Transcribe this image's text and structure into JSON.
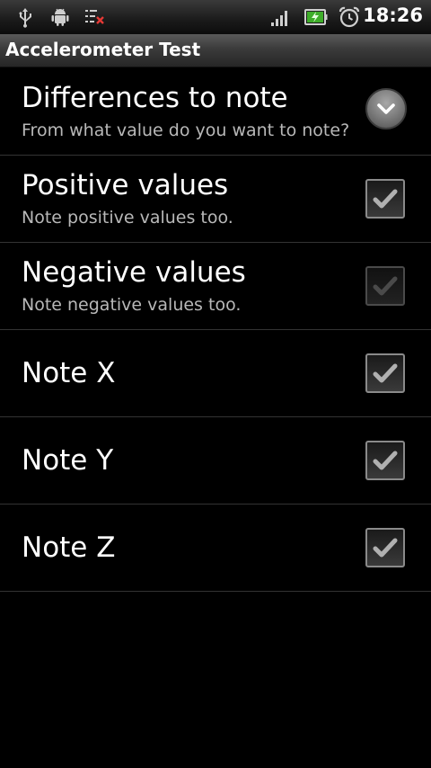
{
  "status_bar": {
    "time": "18:26",
    "left_icons": [
      "usb-icon",
      "android-debug-icon",
      "accelerometer-notification-icon"
    ],
    "right_icons": [
      "signal-icon",
      "battery-charging-icon",
      "alarm-clock-icon"
    ]
  },
  "app": {
    "title": "Accelerometer Test"
  },
  "preferences": [
    {
      "title": "Differences to note",
      "summary": "From what value do you want to note?",
      "widget": "dropdown"
    },
    {
      "title": "Positive values",
      "summary": "Note positive values too.",
      "widget": "checkbox",
      "checked": true,
      "enabled": true
    },
    {
      "title": "Negative values",
      "summary": "Note negative values too.",
      "widget": "checkbox",
      "checked": true,
      "enabled": false
    },
    {
      "title": "Note X",
      "summary": "",
      "widget": "checkbox",
      "checked": true,
      "enabled": true
    },
    {
      "title": "Note Y",
      "summary": "",
      "widget": "checkbox",
      "checked": true,
      "enabled": true
    },
    {
      "title": "Note Z",
      "summary": "",
      "widget": "checkbox",
      "checked": true,
      "enabled": true
    }
  ],
  "colors": {
    "background": "#000000",
    "divider": "#333333",
    "summary_text": "#b8b8b8"
  }
}
